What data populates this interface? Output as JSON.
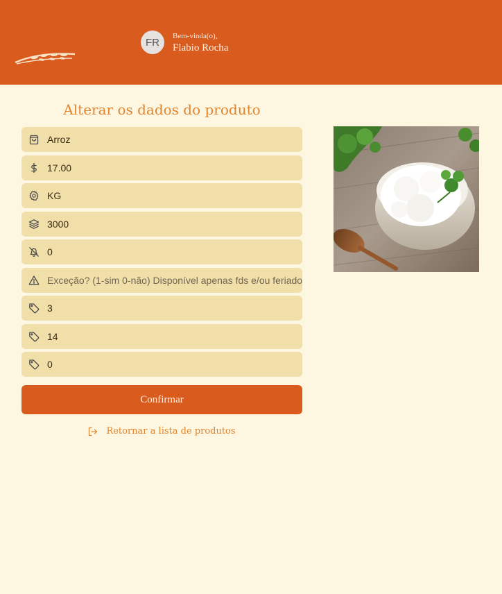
{
  "header": {
    "avatar_initials": "FR",
    "greeting": "Bem-vinda(o),",
    "user_name": "Flabio Rocha",
    "brand_color": "#d95b1e"
  },
  "form": {
    "title": "Alterar os dados do produto",
    "fields": [
      {
        "icon": "shopping-bag-icon",
        "value": "Arroz",
        "placeholder": ""
      },
      {
        "icon": "dollar-sign-icon",
        "value": "17.00",
        "placeholder": ""
      },
      {
        "icon": "gear-icon",
        "value": "KG",
        "placeholder": ""
      },
      {
        "icon": "layers-icon",
        "value": "3000",
        "placeholder": ""
      },
      {
        "icon": "bell-off-icon",
        "value": "0",
        "placeholder": ""
      },
      {
        "icon": "alert-triangle-icon",
        "value": "",
        "placeholder": "Exceção? (1-sim 0-não) Disponível apenas fds e/ou feriado"
      },
      {
        "icon": "tag-icon",
        "value": "3",
        "placeholder": ""
      },
      {
        "icon": "tag-icon",
        "value": "14",
        "placeholder": ""
      },
      {
        "icon": "tag-icon",
        "value": "0",
        "placeholder": ""
      }
    ],
    "confirm_label": "Confirmar",
    "back_label": "Retornar a lista de produtos"
  },
  "colors": {
    "background": "#fdf6e0",
    "field_bg": "#f1dfaa",
    "accent_text": "#e0852f"
  }
}
